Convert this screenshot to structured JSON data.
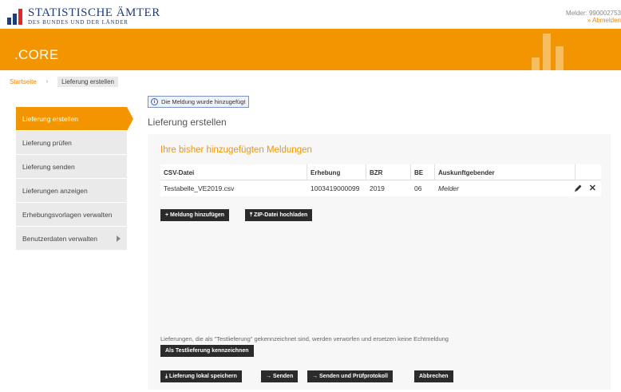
{
  "header": {
    "logo_line1": "STATISTISCHE ÄMTER",
    "logo_line2": "DES BUNDES UND DER LÄNDER",
    "melder": "Melder: 990002753",
    "logout": "» Abmelden"
  },
  "band": {
    "title": ".CORE"
  },
  "breadcrumb": {
    "start": "Startseite",
    "separator": "›",
    "current": "Lieferung erstellen"
  },
  "sidebar": {
    "items": [
      {
        "label": "Lieferung erstellen"
      },
      {
        "label": "Lieferung prüfen"
      },
      {
        "label": "Lieferung senden"
      },
      {
        "label": "Lieferungen anzeigen"
      },
      {
        "label": "Erhebungsvorlagen verwalten"
      },
      {
        "label": "Benutzerdaten verwalten"
      }
    ]
  },
  "notice": {
    "icon": "i",
    "text": "Die Meldung wurde hinzugefügt"
  },
  "page_title": "Lieferung erstellen",
  "panel": {
    "title": "Ihre bisher hinzugefügten Meldungen",
    "table": {
      "headers": [
        "CSV-Datei",
        "Erhebung",
        "BZR",
        "BE",
        "Auskunftgebender",
        ""
      ],
      "rows": [
        {
          "file": "Testabelle_VE2019.csv",
          "erhebung": "1003419000099",
          "bzr": "2019",
          "be": "06",
          "auskunft": "Melder"
        }
      ]
    },
    "buttons": {
      "add": "+ Meldung hinzufügen",
      "zip": "⤒ ZIP-Datei hochladen",
      "test": "Als Testlieferung kennzeichnen",
      "save": "⤓ Lieferung lokal speichern",
      "send": "→ Senden",
      "send_protocol": "→ Senden und Prüfprotokoll",
      "cancel": "Abbrechen"
    },
    "test_note": "Lieferungen, die als \"Testlieferung\" gekennzeichnet sind, werden verworfen und ersetzen keine Echtmeldung"
  },
  "colors": {
    "accent": "#f39500",
    "dark_button": "#2b2b2b",
    "logo_blue": "#1f3d7a",
    "logo_red": "#e3262b"
  }
}
